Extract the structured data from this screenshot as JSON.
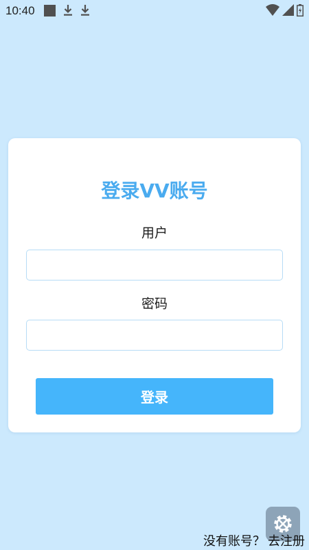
{
  "status_bar": {
    "time": "10:40",
    "left_icons": [
      "stop-square-icon",
      "download-icon",
      "download-icon"
    ],
    "right_icons": [
      "wifi-icon",
      "signal-icon",
      "battery-icon"
    ]
  },
  "login": {
    "title": "登录VV账号",
    "user_label": "用户",
    "user_value": "",
    "password_label": "密码",
    "password_value": "",
    "submit_label": "登录"
  },
  "footer": {
    "register_prompt": "没有账号？",
    "register_link": "去注册"
  },
  "floating": {
    "icon": "settings-tools-icon"
  },
  "colors": {
    "background": "#cce9fd",
    "accent": "#4aabef",
    "button": "#45b5fb",
    "input_border": "#b6dcf6"
  }
}
